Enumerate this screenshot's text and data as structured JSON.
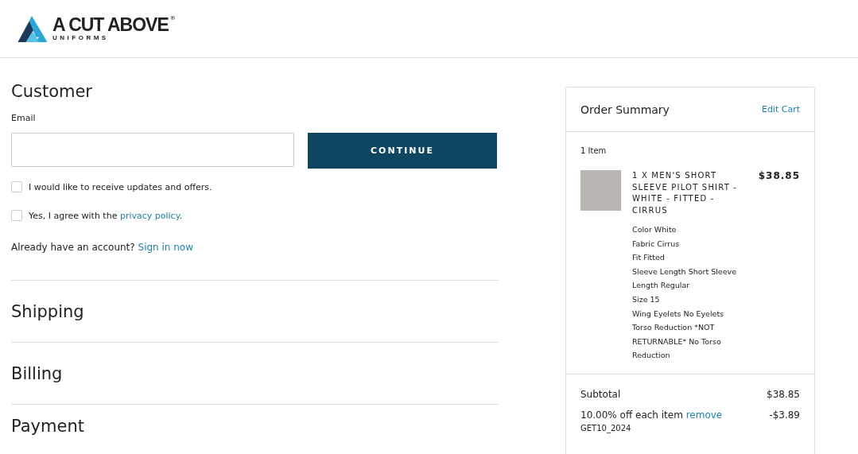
{
  "header": {
    "logo": {
      "name": "A CUT ABOVE",
      "reg": "®",
      "sub": "UNIFORMS"
    }
  },
  "customer": {
    "title": "Customer",
    "email_label": "Email",
    "continue_button": "CONTINUE",
    "checkboxes": [
      {
        "text": "I would like to receive updates and offers.",
        "checked": false
      },
      {
        "text": "Yes, I agree with the ",
        "link": "privacy policy",
        "after": ".",
        "checked": false
      }
    ],
    "account_prompt": "Already have an account?",
    "sign_in_link": "Sign in now"
  },
  "sections": [
    {
      "title": "Shipping"
    },
    {
      "title": "Billing"
    },
    {
      "title": "Payment"
    }
  ],
  "order_summary": {
    "title": "Order Summary",
    "edit_link": "Edit Cart",
    "item_count": "1 Item",
    "items": [
      {
        "name": "1 X MEN'S SHORT SLEEVE PILOT SHIRT - WHITE - FITTED - CIRRUS",
        "price": "$38.85",
        "options": [
          "Color White",
          "Fabric Cirrus",
          "Fit Fitted",
          "Sleeve Length Short Sleeve",
          "Length Regular",
          "Size 15",
          "Wing Eyelets No Eyelets",
          "Torso Reduction *NOT RETURNABLE* No Torso Reduction"
        ]
      }
    ],
    "subtotal_label": "Subtotal",
    "subtotal": "$38.85",
    "discount": {
      "label": "10.00% off each item",
      "link": "remove",
      "amount": "-$3.89",
      "code": "GET10_2024"
    }
  }
}
